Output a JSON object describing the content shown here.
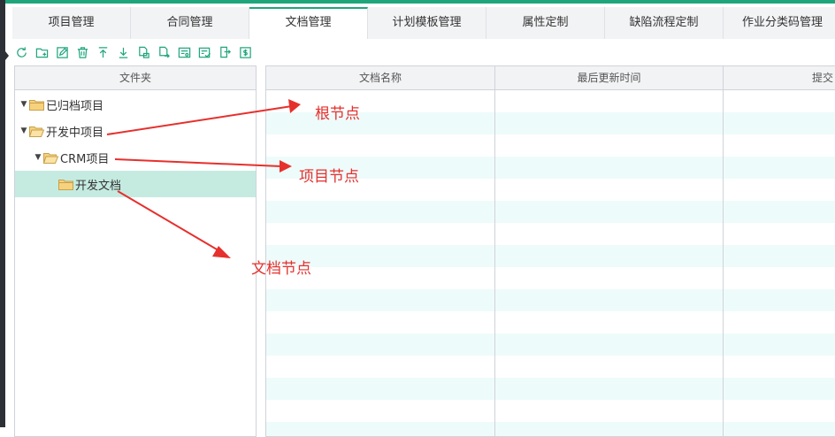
{
  "tabs": [
    {
      "label": "项目管理",
      "active": false
    },
    {
      "label": "合同管理",
      "active": false
    },
    {
      "label": "文档管理",
      "active": true
    },
    {
      "label": "计划模板管理",
      "active": false
    },
    {
      "label": "属性定制",
      "active": false
    },
    {
      "label": "缺陷流程定制",
      "active": false
    },
    {
      "label": "作业分类码管理",
      "active": false
    }
  ],
  "toolbar": {
    "icons": [
      "refresh-icon",
      "new-folder-icon",
      "edit-icon",
      "delete-icon",
      "upload-icon",
      "download-icon",
      "file-copy-icon",
      "file-move-icon",
      "document-settings-icon",
      "checklist-icon",
      "export-icon",
      "dollar-icon"
    ]
  },
  "folder_panel": {
    "header": "文件夹",
    "items": [
      {
        "label": "已归档项目",
        "expanded": true,
        "selected": false
      },
      {
        "label": "开发中项目",
        "expanded": true,
        "selected": false
      },
      {
        "label": "CRM项目",
        "expanded": true,
        "selected": false
      },
      {
        "label": "开发文档",
        "expanded": false,
        "selected": true
      }
    ]
  },
  "document_grid": {
    "columns": [
      "文档名称",
      "最后更新时间",
      "提交"
    ]
  },
  "annotations": {
    "root_node": "根节点",
    "project_node": "项目节点",
    "document_node": "文档节点"
  },
  "colors": {
    "accent": "#1fa57c",
    "selected_row": "#c5ebe1",
    "alt_row": "#eefbfb",
    "annotation": "#e6302d"
  }
}
